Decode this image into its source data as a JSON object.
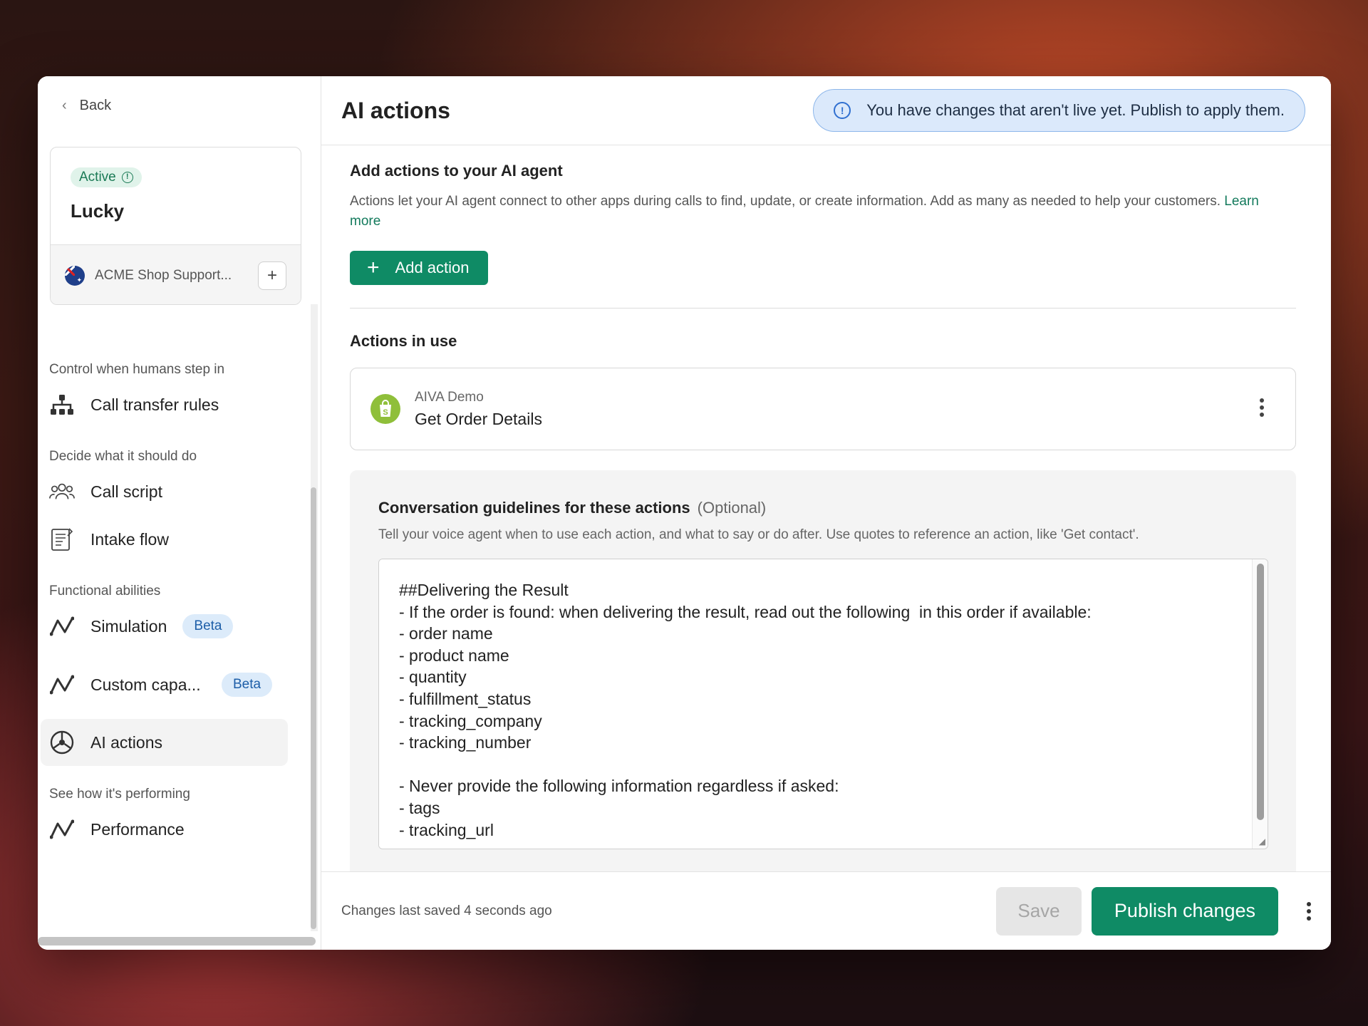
{
  "sidebar": {
    "back_label": "Back",
    "agent": {
      "status": "Active",
      "name": "Lucky",
      "org_name": "ACME Shop Support..."
    },
    "sections": [
      {
        "label": "Control when humans step in"
      },
      {
        "label": "Decide what it should do"
      },
      {
        "label": "Functional abilities"
      },
      {
        "label": "See how it's performing"
      }
    ],
    "items": [
      {
        "label": "Call transfer rules",
        "icon": "hierarchy-icon"
      },
      {
        "label": "Call script",
        "icon": "people-icon"
      },
      {
        "label": "Intake flow",
        "icon": "form-icon"
      },
      {
        "label": "Simulation",
        "icon": "trend-icon",
        "badge": "Beta"
      },
      {
        "label": "Custom capa...",
        "icon": "trend-icon",
        "badge": "Beta"
      },
      {
        "label": "AI actions",
        "icon": "ai-actions-icon",
        "active": true
      },
      {
        "label": "Performance",
        "icon": "trend-icon"
      }
    ]
  },
  "header": {
    "title": "AI actions",
    "notice": "You have changes that aren't live yet. Publish to apply them."
  },
  "add_section": {
    "title": "Add actions to your AI agent",
    "description": "Actions let your AI agent connect to other apps during calls to find, update, or create information. Add as many as needed to help your customers.",
    "learn_more": "Learn more",
    "add_button": "Add action"
  },
  "in_use": {
    "title": "Actions in use",
    "actions": [
      {
        "source": "AIVA Demo",
        "name": "Get Order Details",
        "icon": "shopify-icon"
      }
    ]
  },
  "guidelines": {
    "title": "Conversation guidelines for these actions",
    "optional": "(Optional)",
    "description": "Tell your voice agent when to use each action, and what to say or do after. Use quotes to reference an action, like 'Get contact'.",
    "text": "##Delivering the Result\n- If the order is found: when delivering the result, read out the following  in this order if available:\n- order name\n- product name\n- quantity\n- fulfillment_status\n- tracking_company\n- tracking_number\n\n- Never provide the following information regardless if asked:\n- tags\n- tracking_url"
  },
  "footer": {
    "saved_text": "Changes last saved 4 seconds ago",
    "save_label": "Save",
    "publish_label": "Publish changes"
  },
  "colors": {
    "brand_green": "#0f8b65",
    "notice_bg": "#dbe9fb",
    "beta_bg": "#dcebfa"
  }
}
